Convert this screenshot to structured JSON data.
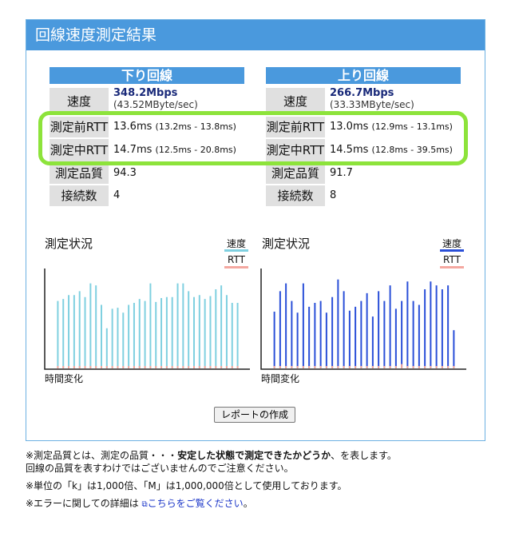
{
  "header": {
    "title": "回線速度測定結果"
  },
  "download": {
    "title": "下り回線",
    "speed_label": "速度",
    "speed_main": "348.2Mbps",
    "speed_sub": "(43.52MByte/sec)",
    "pre_rtt_label": "測定前RTT",
    "pre_rtt": "13.6ms",
    "pre_rtt_range": "(13.2ms - 13.8ms)",
    "mid_rtt_label": "測定中RTT",
    "mid_rtt": "14.7ms",
    "mid_rtt_range": "(12.5ms - 20.8ms)",
    "quality_label": "測定品質",
    "quality": "94.3",
    "conn_label": "接続数",
    "conn": "4"
  },
  "upload": {
    "title": "上り回線",
    "speed_label": "速度",
    "speed_main": "266.7Mbps",
    "speed_sub": "(33.33MByte/sec)",
    "pre_rtt_label": "測定前RTT",
    "pre_rtt": "13.0ms",
    "pre_rtt_range": "(12.9ms - 13.1ms)",
    "mid_rtt_label": "測定中RTT",
    "mid_rtt": "14.5ms",
    "mid_rtt_range": "(12.8ms - 39.5ms)",
    "quality_label": "測定品質",
    "quality": "91.7",
    "conn_label": "接続数",
    "conn": "8"
  },
  "charts": {
    "title": "測定状況",
    "legend_speed": "速度",
    "legend_rtt": "RTT",
    "xlabel": "時間変化",
    "download_speed_color": "#7fd0e0",
    "upload_speed_color": "#2a4fd8",
    "rtt_color": "#f4a8a0"
  },
  "chart_data": [
    {
      "type": "bar",
      "title": "測定状況",
      "xlabel": "時間変化",
      "ylim": [
        0,
        1
      ],
      "series": [
        {
          "name": "速度",
          "values": [
            0.7,
            0.72,
            0.76,
            0.76,
            0.8,
            0.74,
            0.88,
            0.86,
            0.66,
            0.42,
            0.62,
            0.63,
            0.58,
            0.66,
            0.68,
            0.72,
            0.7,
            0.88,
            0.69,
            0.73,
            0.74,
            0.74,
            0.88,
            0.88,
            0.8,
            0.74,
            0.76,
            0.72,
            0.75,
            0.82,
            0.86,
            0.76,
            0.68,
            0.68
          ]
        },
        {
          "name": "RTT",
          "values": [
            0.05,
            0.05,
            0.05,
            0.05,
            0.05,
            0.05,
            0.05,
            0.05,
            0.05,
            0.05,
            0.05,
            0.05,
            0.05,
            0.05,
            0.05,
            0.05,
            0.05,
            0.05,
            0.05,
            0.05,
            0.05,
            0.05,
            0.05,
            0.05,
            0.05,
            0.05,
            0.05,
            0.05,
            0.05,
            0.05,
            0.05,
            0.05,
            0.05,
            0.05
          ]
        }
      ]
    },
    {
      "type": "bar",
      "title": "測定状況",
      "xlabel": "時間変化",
      "ylim": [
        0,
        1
      ],
      "series": [
        {
          "name": "速度",
          "values": [
            0.59,
            0.8,
            0.88,
            0.7,
            0.58,
            0.88,
            0.64,
            0.68,
            0.7,
            0.58,
            0.74,
            0.92,
            0.8,
            0.6,
            0.64,
            0.7,
            0.78,
            0.54,
            0.8,
            0.7,
            0.86,
            0.62,
            0.7,
            0.9,
            0.7,
            0.66,
            0.82,
            0.9,
            0.86,
            0.82,
            0.86,
            0.4
          ]
        },
        {
          "name": "RTT",
          "values": [
            0.05,
            0.05,
            0.05,
            0.05,
            0.05,
            0.05,
            0.05,
            0.05,
            0.05,
            0.05,
            0.05,
            0.05,
            0.05,
            0.05,
            0.05,
            0.05,
            0.05,
            0.05,
            0.05,
            0.05,
            0.05,
            0.05,
            0.09,
            0.05,
            0.05,
            0.05,
            0.05,
            0.05,
            0.05,
            0.05,
            0.05,
            0.05
          ]
        }
      ]
    }
  ],
  "notes": {
    "line1_a": "※測定品質とは、測定の品質・・・",
    "line1_b": "安定した状態で測定できたかどうか",
    "line1_c": "、を表します。",
    "line2": "回線の品質を表すわけではございませんのでご注意ください。",
    "line3": "※単位の「k」は1,000倍、「M」は1,000,000倍として使用しております。",
    "line4_a": "※エラーに関しての詳細は",
    "line4_link": "こちらをご覧ください",
    "line4_c": "。"
  },
  "report_button": "レポートの作成"
}
